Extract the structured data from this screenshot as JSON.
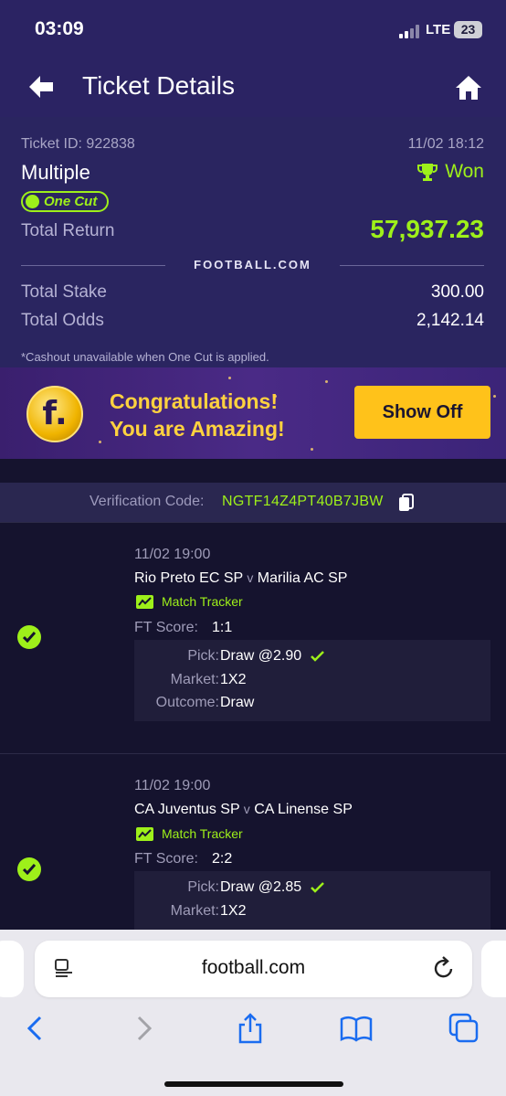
{
  "status_bar": {
    "time": "03:09",
    "network": "LTE",
    "battery": "23"
  },
  "header": {
    "title": "Ticket Details"
  },
  "ticket": {
    "id_label": "Ticket ID: 922838",
    "datetime": "11/02 18:12",
    "type": "Multiple",
    "status": "Won",
    "one_cut_label": "One Cut",
    "total_return_label": "Total Return",
    "total_return_value": "57,937.23",
    "brand": "FOOTBALL.COM",
    "total_stake_label": "Total Stake",
    "total_stake_value": "300.00",
    "total_odds_label": "Total Odds",
    "total_odds_value": "2,142.14",
    "note": "*Cashout unavailable when One Cut is applied."
  },
  "banner": {
    "line1": "Congratulations!",
    "line2": "You are Amazing!",
    "button": "Show Off",
    "accent": "#ffc21a"
  },
  "verification": {
    "label": "Verification Code:",
    "code": "NGTF14Z4PT40B7JBW"
  },
  "selections": [
    {
      "date": "11/02 19:00",
      "home": "Rio Preto EC SP",
      "vs": "v",
      "away": "Marilia AC SP",
      "tracker_label": "Match Tracker",
      "score_label": "FT Score:",
      "score": "1:1",
      "pick_label": "Pick:",
      "pick": "Draw @2.90",
      "market_label": "Market:",
      "market": "1X2",
      "outcome_label": "Outcome:",
      "outcome": "Draw",
      "won": true
    },
    {
      "date": "11/02 19:00",
      "home": "CA Juventus SP",
      "vs": "v",
      "away": "CA Linense SP",
      "tracker_label": "Match Tracker",
      "score_label": "FT Score:",
      "score": "2:2",
      "pick_label": "Pick:",
      "pick": "Draw @2.85",
      "market_label": "Market:",
      "market": "1X2",
      "won": true
    }
  ],
  "browser": {
    "url": "football.com"
  },
  "colors": {
    "win_green": "#9ef01a",
    "header_bg": "#2b2363",
    "page_bg": "#15132e"
  }
}
